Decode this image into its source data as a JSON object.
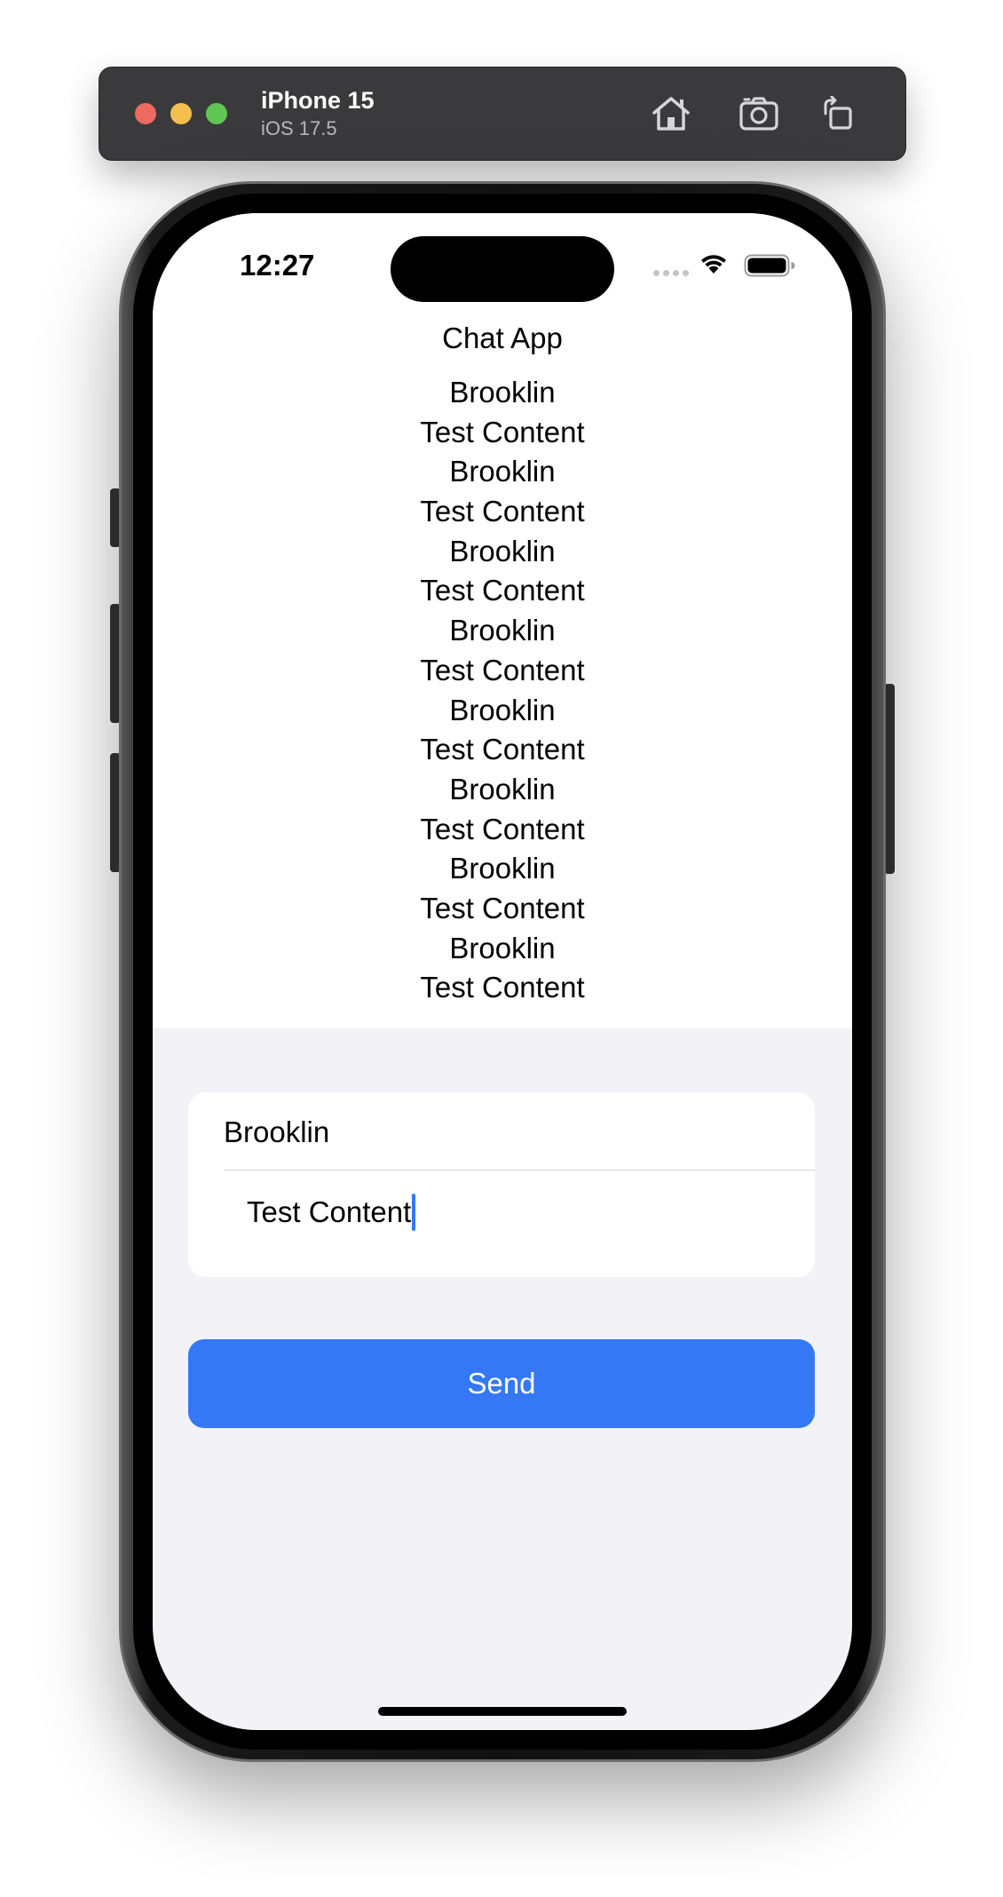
{
  "simulator": {
    "device_name": "iPhone 15",
    "os_version": "iOS 17.5",
    "buttons": [
      "home-icon",
      "screenshot-icon",
      "rotate-icon"
    ]
  },
  "status_bar": {
    "time": "12:27"
  },
  "app": {
    "title": "Chat App"
  },
  "messages": [
    {
      "name": "Brooklin",
      "content": "Test Content"
    },
    {
      "name": "Brooklin",
      "content": "Test Content"
    },
    {
      "name": "Brooklin",
      "content": "Test Content"
    },
    {
      "name": "Brooklin",
      "content": "Test Content"
    },
    {
      "name": "Brooklin",
      "content": "Test Content"
    },
    {
      "name": "Brooklin",
      "content": "Test Content"
    },
    {
      "name": "Brooklin",
      "content": "Test Content"
    },
    {
      "name": "Brooklin",
      "content": "Test Content"
    }
  ],
  "form": {
    "name_value": "Brooklin",
    "content_value": "Test Content",
    "send_label": "Send"
  },
  "colors": {
    "accent": "#3478f6",
    "form_background": "#f2f2f7"
  }
}
